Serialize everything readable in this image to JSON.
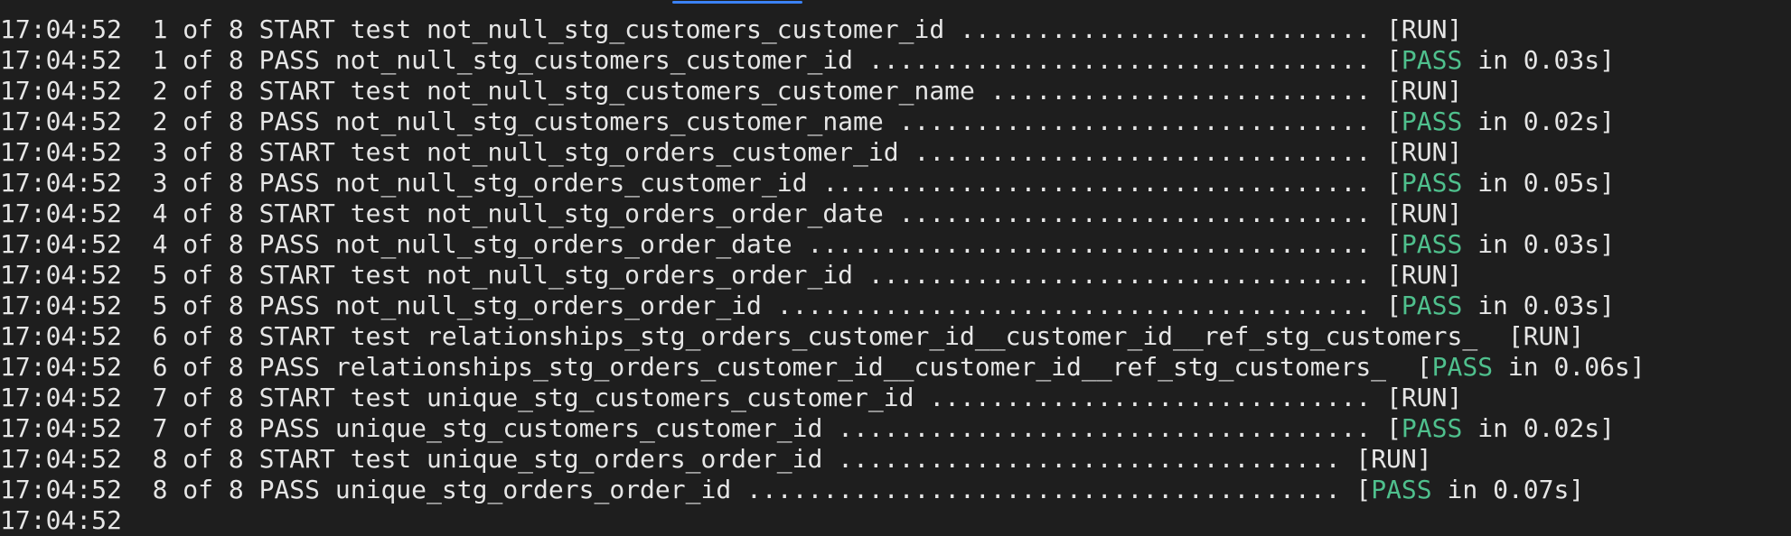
{
  "theme": {
    "background": "#1e1e1e",
    "text": "#e6e6e6",
    "pass_color": "#4fc08d",
    "scroll_indicator": "#3b82f6"
  },
  "lines": [
    {
      "time": "17:04:52",
      "seq": "1 of 8",
      "message": "START test not_null_stg_customers_customer_id",
      "dots": " ........................... ",
      "kind": "run",
      "tag": "[RUN]"
    },
    {
      "time": "17:04:52",
      "seq": "1 of 8",
      "message": "PASS not_null_stg_customers_customer_id",
      "dots": " ................................. ",
      "kind": "pass",
      "open": "[",
      "status": "PASS",
      "duration": " in 0.03s",
      "close": "]"
    },
    {
      "time": "17:04:52",
      "seq": "2 of 8",
      "message": "START test not_null_stg_customers_customer_name",
      "dots": " ......................... ",
      "kind": "run",
      "tag": "[RUN]"
    },
    {
      "time": "17:04:52",
      "seq": "2 of 8",
      "message": "PASS not_null_stg_customers_customer_name",
      "dots": " ............................... ",
      "kind": "pass",
      "open": "[",
      "status": "PASS",
      "duration": " in 0.02s",
      "close": "]"
    },
    {
      "time": "17:04:52",
      "seq": "3 of 8",
      "message": "START test not_null_stg_orders_customer_id",
      "dots": " .............................. ",
      "kind": "run",
      "tag": "[RUN]"
    },
    {
      "time": "17:04:52",
      "seq": "3 of 8",
      "message": "PASS not_null_stg_orders_customer_id",
      "dots": " .................................... ",
      "kind": "pass",
      "open": "[",
      "status": "PASS",
      "duration": " in 0.05s",
      "close": "]"
    },
    {
      "time": "17:04:52",
      "seq": "4 of 8",
      "message": "START test not_null_stg_orders_order_date",
      "dots": " ............................... ",
      "kind": "run",
      "tag": "[RUN]"
    },
    {
      "time": "17:04:52",
      "seq": "4 of 8",
      "message": "PASS not_null_stg_orders_order_date",
      "dots": " ..................................... ",
      "kind": "pass",
      "open": "[",
      "status": "PASS",
      "duration": " in 0.03s",
      "close": "]"
    },
    {
      "time": "17:04:52",
      "seq": "5 of 8",
      "message": "START test not_null_stg_orders_order_id",
      "dots": " ................................. ",
      "kind": "run",
      "tag": "[RUN]"
    },
    {
      "time": "17:04:52",
      "seq": "5 of 8",
      "message": "PASS not_null_stg_orders_order_id",
      "dots": " ....................................... ",
      "kind": "pass",
      "open": "[",
      "status": "PASS",
      "duration": " in 0.03s",
      "close": "]"
    },
    {
      "time": "17:04:52",
      "seq": "6 of 8",
      "message": "START test relationships_stg_orders_customer_id__customer_id__ref_stg_customers_",
      "dots": "  ",
      "kind": "run",
      "tag": "[RUN]"
    },
    {
      "time": "17:04:52",
      "seq": "6 of 8",
      "message": "PASS relationships_stg_orders_customer_id__customer_id__ref_stg_customers_",
      "dots": "  ",
      "kind": "pass",
      "open": "[",
      "status": "PASS",
      "duration": " in 0.06s",
      "close": "]"
    },
    {
      "time": "17:04:52",
      "seq": "7 of 8",
      "message": "START test unique_stg_customers_customer_id",
      "dots": " ............................. ",
      "kind": "run",
      "tag": "[RUN]"
    },
    {
      "time": "17:04:52",
      "seq": "7 of 8",
      "message": "PASS unique_stg_customers_customer_id",
      "dots": " ................................... ",
      "kind": "pass",
      "open": "[",
      "status": "PASS",
      "duration": " in 0.02s",
      "close": "]"
    },
    {
      "time": "17:04:52",
      "seq": "8 of 8",
      "message": "START test unique_stg_orders_order_id",
      "dots": " ................................. ",
      "kind": "run",
      "tag": "[RUN]"
    },
    {
      "time": "17:04:52",
      "seq": "8 of 8",
      "message": "PASS unique_stg_orders_order_id",
      "dots": " ....................................... ",
      "kind": "pass",
      "open": "[",
      "status": "PASS",
      "duration": " in 0.07s",
      "close": "]"
    }
  ],
  "partial_line": "17:04:52"
}
